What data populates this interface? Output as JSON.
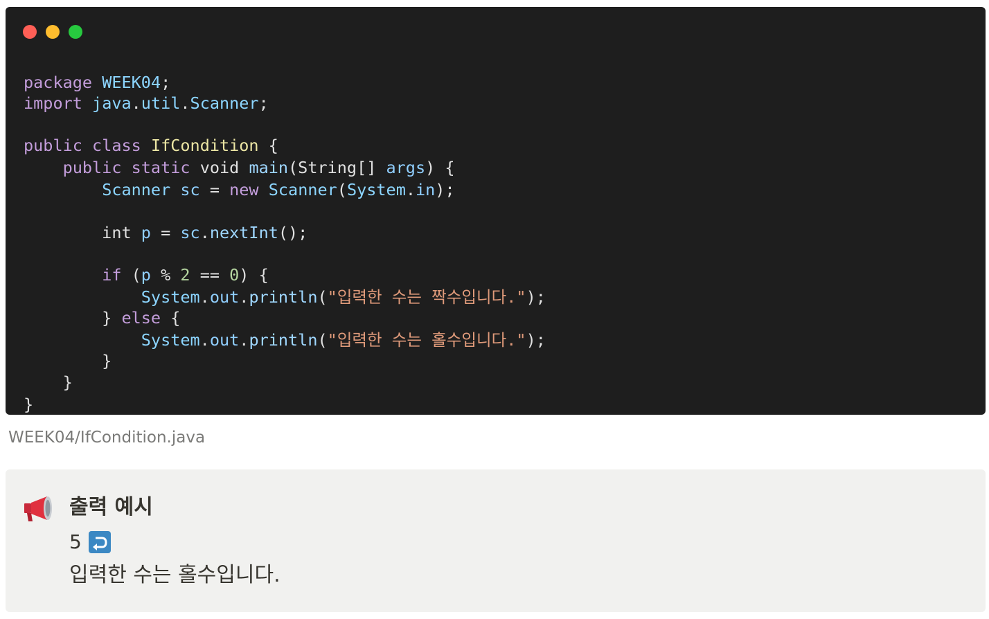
{
  "window_controls": [
    "close-dot",
    "minimize-dot",
    "maximize-dot"
  ],
  "code": {
    "language": "java",
    "lines": [
      [
        [
          "kw",
          "package"
        ],
        [
          "plain",
          " "
        ],
        [
          "ty",
          "WEEK04"
        ],
        [
          "plain",
          ";"
        ]
      ],
      [
        [
          "kw",
          "import"
        ],
        [
          "plain",
          " "
        ],
        [
          "ty",
          "java"
        ],
        [
          "plain",
          "."
        ],
        [
          "ty",
          "util"
        ],
        [
          "plain",
          "."
        ],
        [
          "ty",
          "Scanner"
        ],
        [
          "plain",
          ";"
        ]
      ],
      [
        [
          "kw",
          "public"
        ],
        [
          "plain",
          " "
        ],
        [
          "kw",
          "class"
        ],
        [
          "plain",
          " "
        ],
        [
          "cls",
          "IfCondition"
        ],
        [
          "plain",
          " {"
        ]
      ],
      [
        [
          "plain",
          "    "
        ],
        [
          "kw",
          "public"
        ],
        [
          "plain",
          " "
        ],
        [
          "kw",
          "static"
        ],
        [
          "plain",
          " "
        ],
        [
          "plain",
          "void"
        ],
        [
          "plain",
          " "
        ],
        [
          "fn",
          "main"
        ],
        [
          "plain",
          "(String[] "
        ],
        [
          "var",
          "args"
        ],
        [
          "plain",
          ") {"
        ]
      ],
      [
        [
          "plain",
          "        "
        ],
        [
          "ty",
          "Scanner"
        ],
        [
          "plain",
          " "
        ],
        [
          "var",
          "sc"
        ],
        [
          "plain",
          " = "
        ],
        [
          "kw",
          "new"
        ],
        [
          "plain",
          " "
        ],
        [
          "ty",
          "Scanner"
        ],
        [
          "plain",
          "("
        ],
        [
          "ty",
          "System"
        ],
        [
          "plain",
          "."
        ],
        [
          "var",
          "in"
        ],
        [
          "plain",
          ");"
        ]
      ],
      [
        [
          "plain",
          "        int "
        ],
        [
          "var",
          "p"
        ],
        [
          "plain",
          " = "
        ],
        [
          "var",
          "sc"
        ],
        [
          "plain",
          "."
        ],
        [
          "fn",
          "nextInt"
        ],
        [
          "plain",
          "();"
        ]
      ],
      [
        [
          "plain",
          "        "
        ],
        [
          "kw",
          "if"
        ],
        [
          "plain",
          " ("
        ],
        [
          "var",
          "p"
        ],
        [
          "plain",
          " % "
        ],
        [
          "num",
          "2"
        ],
        [
          "plain",
          " == "
        ],
        [
          "num",
          "0"
        ],
        [
          "plain",
          ") {"
        ]
      ],
      [
        [
          "plain",
          "            "
        ],
        [
          "ty",
          "System"
        ],
        [
          "plain",
          "."
        ],
        [
          "var",
          "out"
        ],
        [
          "plain",
          "."
        ],
        [
          "fn",
          "println"
        ],
        [
          "plain",
          "("
        ],
        [
          "str",
          "\"입력한 수는 짝수입니다.\""
        ],
        [
          "plain",
          ");"
        ]
      ],
      [
        [
          "plain",
          "        } "
        ],
        [
          "kw",
          "else"
        ],
        [
          "plain",
          " {"
        ]
      ],
      [
        [
          "plain",
          "            "
        ],
        [
          "ty",
          "System"
        ],
        [
          "plain",
          "."
        ],
        [
          "var",
          "out"
        ],
        [
          "plain",
          "."
        ],
        [
          "fn",
          "println"
        ],
        [
          "plain",
          "("
        ],
        [
          "str",
          "\"입력한 수는 홀수입니다.\""
        ],
        [
          "plain",
          ");"
        ]
      ],
      [
        [
          "plain",
          "        }"
        ]
      ],
      [
        [
          "plain",
          "    }"
        ]
      ],
      [
        [
          "plain",
          "}"
        ]
      ]
    ]
  },
  "caption": "WEEK04/IfCondition.java",
  "callout": {
    "icon": "megaphone-icon",
    "title": "출력 예시",
    "input_value": "5",
    "input_icon": "return-arrow-icon",
    "output_text": "입력한 수는 홀수입니다."
  }
}
